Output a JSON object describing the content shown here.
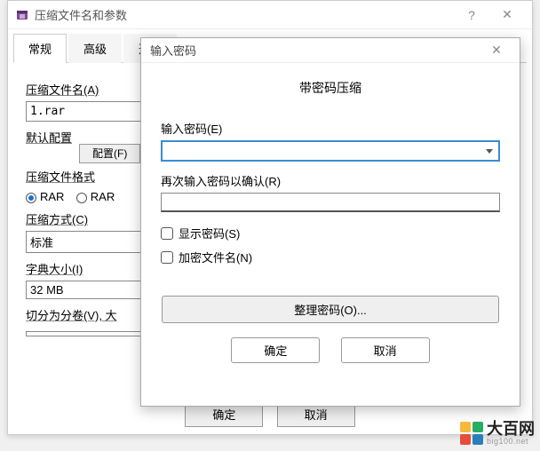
{
  "main": {
    "title": "压缩文件名和参数",
    "tabs": [
      "常规",
      "高级",
      "选项"
    ],
    "filename_label": "压缩文件名(A)",
    "filename_value": "1.rar",
    "profile_label": "默认配置",
    "config_button": "配置(F)",
    "format_label": "压缩文件格式",
    "format_rar": "RAR",
    "format_rar5": "RAR",
    "method_label": "压缩方式(C)",
    "method_value": "标准",
    "dict_label": "字典大小(I)",
    "dict_value": "32 MB",
    "split_label": "切分为分卷(V), 大",
    "ok": "确定",
    "cancel": "取消"
  },
  "modal": {
    "title": "输入密码",
    "heading": "带密码压缩",
    "password_label": "输入密码(E)",
    "confirm_label": "再次输入密码以确认(R)",
    "show_password": "显示密码(S)",
    "encrypt_names": "加密文件名(N)",
    "organize": "整理密码(O)...",
    "ok": "确定",
    "cancel": "取消"
  },
  "watermark": {
    "brand": "大百网",
    "domain": "big100.net"
  }
}
